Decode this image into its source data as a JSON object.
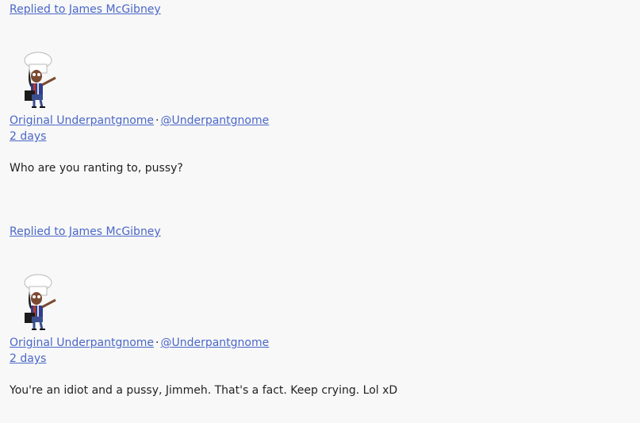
{
  "posts": [
    {
      "reply_to_label": "Replied to James McGibney",
      "author_name": "Original Underpantgnome",
      "separator": "·",
      "handle": "@Underpantgnome",
      "time": "2 days",
      "text": "Who are you ranting to, pussy?"
    },
    {
      "reply_to_label": "Replied to James McGibney",
      "author_name": "Original Underpantgnome",
      "separator": "·",
      "handle": "@Underpantgnome",
      "time": "2 days",
      "text": "You're an idiot and a pussy, Jimmeh. That's a fact. Keep crying. Lol xD"
    }
  ],
  "colors": {
    "background": "#f8f8f8",
    "link": "#4a67c8",
    "text": "#222222"
  }
}
